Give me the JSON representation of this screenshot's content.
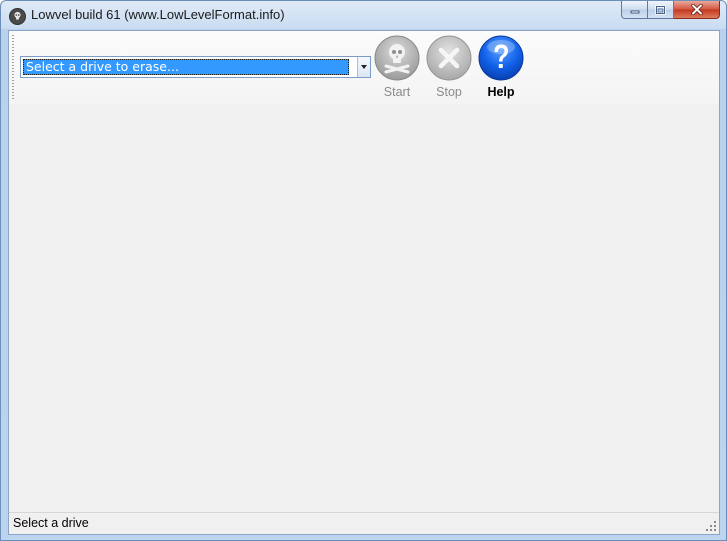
{
  "window": {
    "title": "Lowvel build 61 (www.LowLevelFormat.info)"
  },
  "toolbar": {
    "drive_select": {
      "value": "Select a drive to erase..."
    },
    "start_label": "Start",
    "stop_label": "Stop",
    "help_label": "Help"
  },
  "status": {
    "text": "Select a drive"
  },
  "icons": {
    "app": "skull-app-icon",
    "start": "skull-crossbones-icon",
    "stop": "x-icon",
    "help": "question-mark-icon"
  },
  "colors": {
    "selection": "#3399ff",
    "help_blue": "#1060e8",
    "close_red": "#c4361f",
    "disabled_gray": "#b8b8b8"
  }
}
